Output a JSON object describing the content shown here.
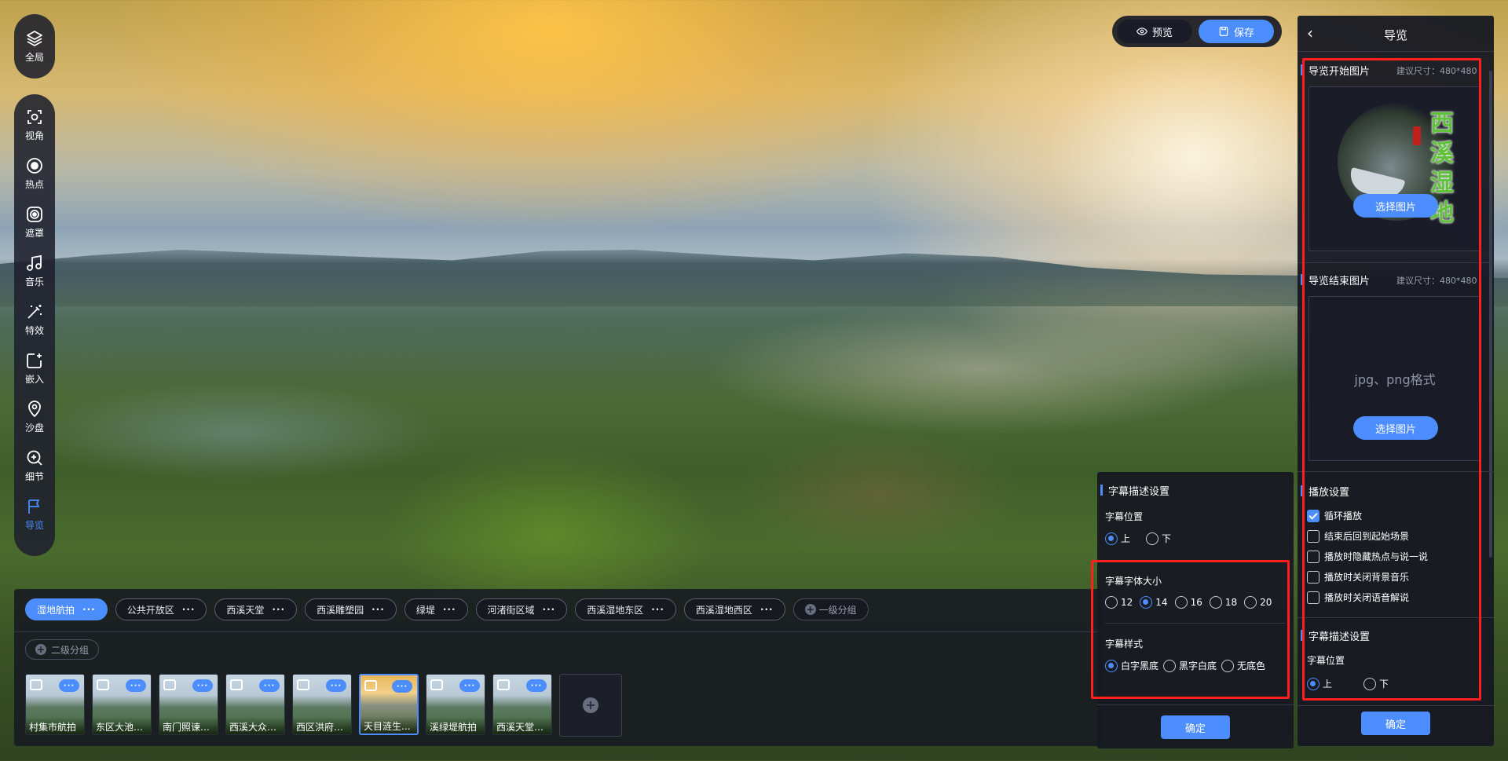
{
  "left_toolbar": {
    "top_item": {
      "label": "全局",
      "icon": "layers-icon"
    },
    "items": [
      {
        "label": "视角",
        "icon": "viewpoint-icon"
      },
      {
        "label": "热点",
        "icon": "hotspot-icon"
      },
      {
        "label": "遮罩",
        "icon": "mask-icon"
      },
      {
        "label": "音乐",
        "icon": "music-icon"
      },
      {
        "label": "特效",
        "icon": "effects-icon"
      },
      {
        "label": "嵌入",
        "icon": "embed-icon"
      },
      {
        "label": "沙盘",
        "icon": "sandtable-icon"
      },
      {
        "label": "细节",
        "icon": "zoom-detail-icon"
      },
      {
        "label": "导览",
        "icon": "flag-icon",
        "active": true
      }
    ]
  },
  "top_actions": {
    "preview_label": "预览",
    "save_label": "保存"
  },
  "scene_panel": {
    "groups": [
      {
        "label": "湿地航拍",
        "active": true
      },
      {
        "label": "公共开放区"
      },
      {
        "label": "西溪天堂"
      },
      {
        "label": "西溪雕塑园"
      },
      {
        "label": "绿堤"
      },
      {
        "label": "河渚街区域"
      },
      {
        "label": "西溪湿地东区"
      },
      {
        "label": "西溪湿地西区"
      }
    ],
    "add_group_label": "一级分组",
    "sub_group_label": "二级分组",
    "scenes": [
      {
        "label": "村集市航拍"
      },
      {
        "label": "东区大池桥..."
      },
      {
        "label": "南门照谏桥..."
      },
      {
        "label": "西溪大众体..."
      },
      {
        "label": "西区洪府航拍"
      },
      {
        "label": "天目涟生...",
        "selected": true
      },
      {
        "label": "溪绿堤航拍"
      },
      {
        "label": "西溪天堂航拍"
      }
    ]
  },
  "subtitle_popup": {
    "title": "字幕描述设置",
    "position_label": "字幕位置",
    "position_options": [
      "上",
      "下"
    ],
    "position_selected": "上",
    "font_size_label": "字幕字体大小",
    "font_sizes": [
      "12",
      "14",
      "16",
      "18",
      "20"
    ],
    "font_size_selected": "14",
    "style_label": "字幕样式",
    "style_options": [
      "白字黑底",
      "黑字白底",
      "无底色"
    ],
    "style_selected": "白字黑底",
    "confirm_label": "确定"
  },
  "right_panel": {
    "title": "导览",
    "start_image": {
      "title": "导览开始图片",
      "hint": "建议尺寸：480*480",
      "logo_text": "西溪湿地",
      "button": "选择图片"
    },
    "end_image": {
      "title": "导览结束图片",
      "hint": "建议尺寸：480*480",
      "placeholder": "jpg、png格式",
      "button": "选择图片"
    },
    "playback": {
      "title": "播放设置",
      "options": [
        {
          "label": "循环播放",
          "checked": true
        },
        {
          "label": "结束后回到起始场景",
          "checked": false
        },
        {
          "label": "播放时隐藏热点与说一说",
          "checked": false
        },
        {
          "label": "播放时关闭背景音乐",
          "checked": false
        },
        {
          "label": "播放时关闭语音解说",
          "checked": false
        }
      ]
    },
    "subtitle": {
      "title": "字幕描述设置",
      "position_label": "字幕位置",
      "position_options": [
        "上",
        "下"
      ],
      "position_selected": "上"
    },
    "confirm_label": "确定"
  },
  "colors": {
    "accent": "#4c8dff",
    "panel_bg": "#16182299",
    "highlight_box": "#ff1f1f"
  }
}
